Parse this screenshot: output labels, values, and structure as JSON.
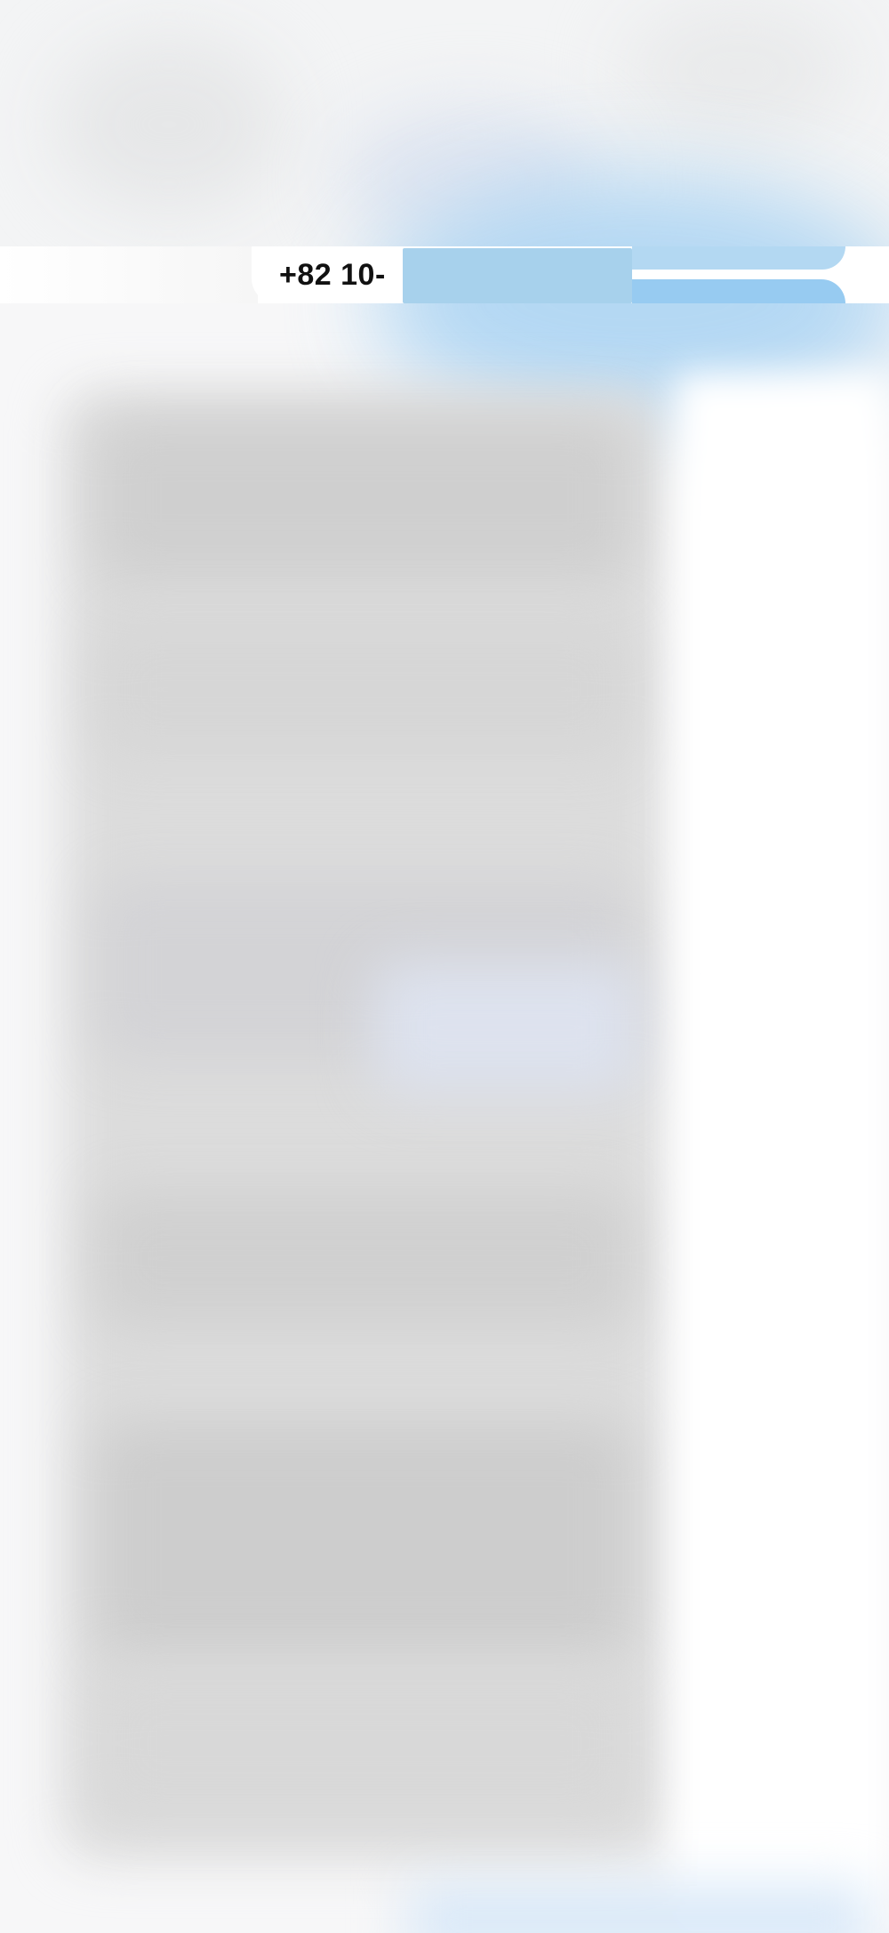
{
  "phone_banner": {
    "number_prefix": "+82 10-",
    "number_redacted": true
  },
  "colors": {
    "highlight_blue": "#a7d1ec",
    "accent_blue": "#97cbf1",
    "background": "#f7f7f8"
  },
  "content": {
    "blurred": true
  }
}
